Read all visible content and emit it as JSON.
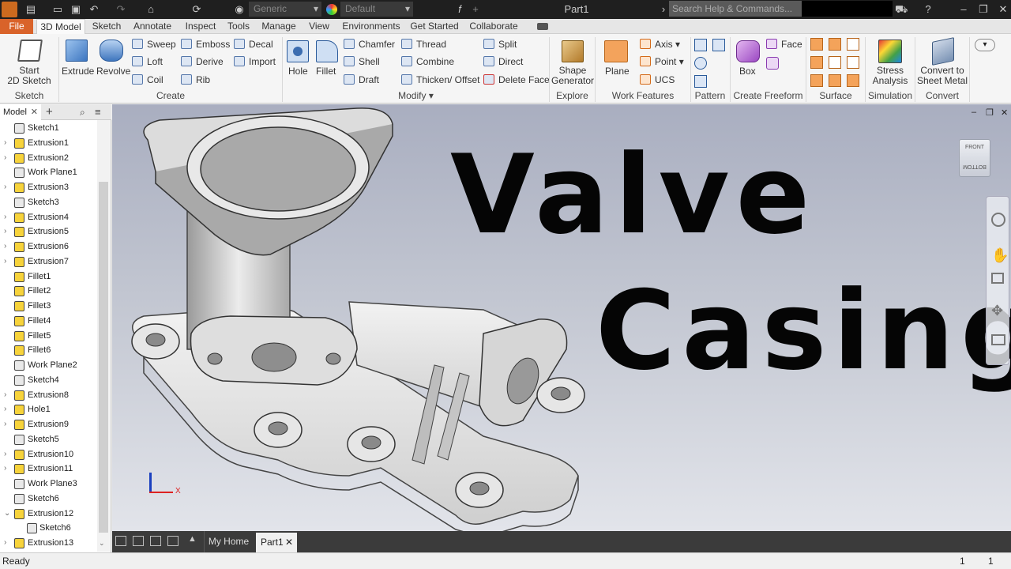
{
  "titlebar": {
    "doc_title": "Part1",
    "material": "Generic",
    "appearance": "Default",
    "search_placeholder": "Search Help & Commands..."
  },
  "menu": {
    "tabs": [
      "File",
      "3D Model",
      "Sketch",
      "Annotate",
      "Inspect",
      "Tools",
      "Manage",
      "View",
      "Environments",
      "Get Started",
      "Collaborate"
    ],
    "active": "3D Model"
  },
  "ribbon": {
    "sketch_group": {
      "start_sketch": "Start",
      "start_sketch2": "2D Sketch",
      "label": "Sketch"
    },
    "create_group": {
      "extrude": "Extrude",
      "revolve": "Revolve",
      "sweep": "Sweep",
      "loft": "Loft",
      "coil": "Coil",
      "emboss": "Emboss",
      "derive": "Derive",
      "rib": "Rib",
      "decal": "Decal",
      "import": "Import",
      "label": "Create"
    },
    "modify_group": {
      "hole": "Hole",
      "fillet": "Fillet",
      "chamfer": "Chamfer",
      "shell": "Shell",
      "draft": "Draft",
      "thread": "Thread",
      "combine": "Combine",
      "thicken": "Thicken/ Offset",
      "split": "Split",
      "direct": "Direct",
      "delete_face": "Delete Face",
      "label": "Modify"
    },
    "explore_group": {
      "shape_generator": "Shape",
      "shape_generator2": "Generator",
      "label": "Explore"
    },
    "work_features_group": {
      "plane": "Plane",
      "axis": "Axis",
      "point": "Point",
      "ucs": "UCS",
      "label": "Work Features"
    },
    "pattern_group": {
      "label": "Pattern"
    },
    "freeform_group": {
      "box": "Box",
      "face": "Face",
      "label": "Create Freeform"
    },
    "surface_group": {
      "label": "Surface"
    },
    "simulation_group": {
      "stress": "Stress",
      "stress2": "Analysis",
      "label": "Simulation"
    },
    "convert_group": {
      "convert": "Convert to",
      "convert2": "Sheet Metal",
      "label": "Convert"
    }
  },
  "browser": {
    "tab_label": "Model",
    "items": [
      {
        "label": "Sketch1",
        "type": "sketch"
      },
      {
        "label": "Extrusion1",
        "type": "extrusion"
      },
      {
        "label": "Extrusion2",
        "type": "extrusion"
      },
      {
        "label": "Work Plane1",
        "type": "workplane"
      },
      {
        "label": "Extrusion3",
        "type": "extrusion"
      },
      {
        "label": "Sketch3",
        "type": "sketch"
      },
      {
        "label": "Extrusion4",
        "type": "extrusion"
      },
      {
        "label": "Extrusion5",
        "type": "extrusion"
      },
      {
        "label": "Extrusion6",
        "type": "extrusion"
      },
      {
        "label": "Extrusion7",
        "type": "extrusion"
      },
      {
        "label": "Fillet1",
        "type": "fillet"
      },
      {
        "label": "Fillet2",
        "type": "fillet"
      },
      {
        "label": "Fillet3",
        "type": "fillet"
      },
      {
        "label": "Fillet4",
        "type": "fillet"
      },
      {
        "label": "Fillet5",
        "type": "fillet"
      },
      {
        "label": "Fillet6",
        "type": "fillet"
      },
      {
        "label": "Work Plane2",
        "type": "workplane"
      },
      {
        "label": "Sketch4",
        "type": "sketch"
      },
      {
        "label": "Extrusion8",
        "type": "extrusion"
      },
      {
        "label": "Hole1",
        "type": "hole"
      },
      {
        "label": "Extrusion9",
        "type": "extrusion"
      },
      {
        "label": "Sketch5",
        "type": "sketch"
      },
      {
        "label": "Extrusion10",
        "type": "extrusion"
      },
      {
        "label": "Extrusion11",
        "type": "extrusion"
      },
      {
        "label": "Work Plane3",
        "type": "workplane"
      },
      {
        "label": "Sketch6",
        "type": "sketch"
      },
      {
        "label": "Extrusion12",
        "type": "extrusion"
      },
      {
        "label": "Sketch6",
        "type": "sketch"
      },
      {
        "label": "Extrusion13",
        "type": "extrusion"
      }
    ]
  },
  "viewport": {
    "title_line1": "Valve",
    "title_line2": "Casing",
    "viewcube_front": "FRONT",
    "viewcube_bottom": "BOTTOM",
    "axis_x": "X"
  },
  "doc_tabs": {
    "home": "My Home",
    "part": "Part1"
  },
  "status": {
    "text": "Ready",
    "count1": "1",
    "count2": "1"
  }
}
